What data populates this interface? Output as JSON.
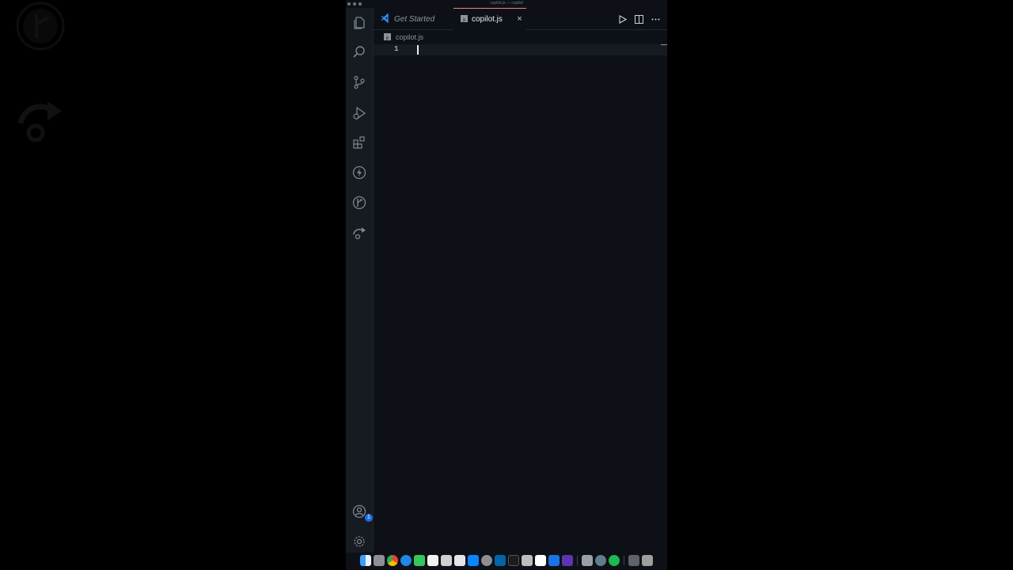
{
  "window": {
    "title": "copilot.js — copilot"
  },
  "tabs": [
    {
      "label": "Get Started",
      "icon": "vscode-icon"
    },
    {
      "label": "copilot.js",
      "icon": "js-file-icon"
    }
  ],
  "breadcrumb": {
    "file": "copilot.js"
  },
  "editor": {
    "line_numbers": [
      "1"
    ]
  },
  "activity_bar": {
    "items": [
      "explorer-icon",
      "search-icon",
      "source-control-icon",
      "run-debug-icon",
      "extensions-icon",
      "thunder-icon",
      "gitlens-icon",
      "remote-icon"
    ],
    "account_badge": "1"
  },
  "colors": {
    "background": "#0d1117",
    "activity_bar": "#161b22",
    "tab_accent": "#f78166",
    "badge": "#1f6feb"
  },
  "dock": {
    "icons": [
      "finder-icon",
      "launchpad-icon",
      "chrome-icon",
      "safari-icon",
      "messages-icon",
      "calendar-icon",
      "notes-icon",
      "reminders-icon",
      "app-store-icon",
      "settings-icon",
      "vscode-icon",
      "terminal-icon",
      "pen-icon",
      "slack-icon",
      "vpn-icon",
      "star-icon",
      "preview-icon",
      "globe-icon",
      "spotify-icon",
      "keyboard-icon",
      "trash-icon"
    ]
  }
}
